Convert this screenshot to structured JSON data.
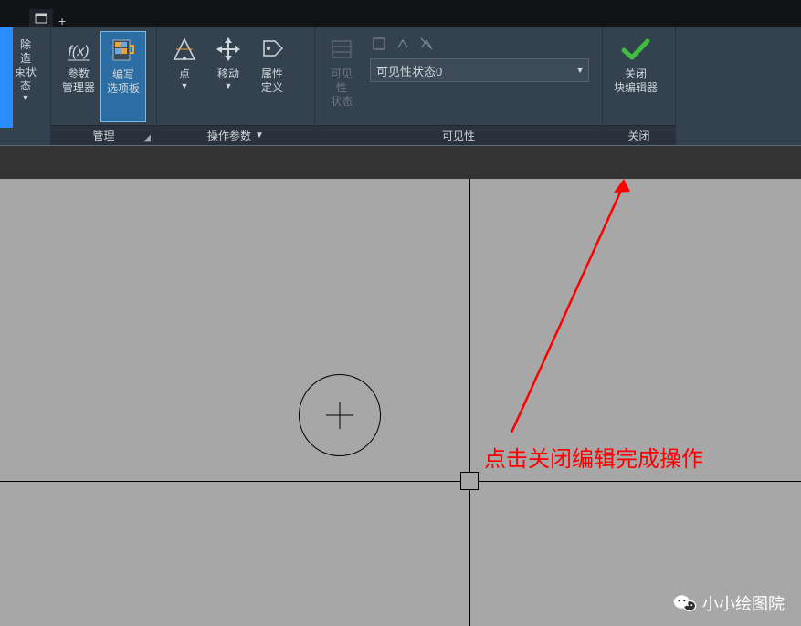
{
  "quickbar": {
    "plus": "+"
  },
  "ribbon": {
    "panels": {
      "left_partial": {
        "line1": "除",
        "line2": "造",
        "line3": "束状态"
      },
      "manage": {
        "title": "管理",
        "param_mgr": {
          "label1": "参数",
          "label2": "管理器"
        },
        "authoring": {
          "label1": "编写",
          "label2": "选项板"
        }
      },
      "action": {
        "title": "操作参数",
        "point": {
          "label": "点"
        },
        "move": {
          "label": "移动"
        },
        "attr": {
          "label1": "属性",
          "label2": "定义"
        }
      },
      "visibility": {
        "title": "可见性",
        "vis_states": {
          "label1": "可见性",
          "label2": "状态"
        },
        "field_value": "可见性状态0"
      },
      "close": {
        "title": "关闭",
        "btn": {
          "label1": "关闭",
          "label2": "块编辑器"
        }
      }
    }
  },
  "annotation_text": "点击关闭编辑完成操作",
  "watermark_text": "小小绘图院"
}
